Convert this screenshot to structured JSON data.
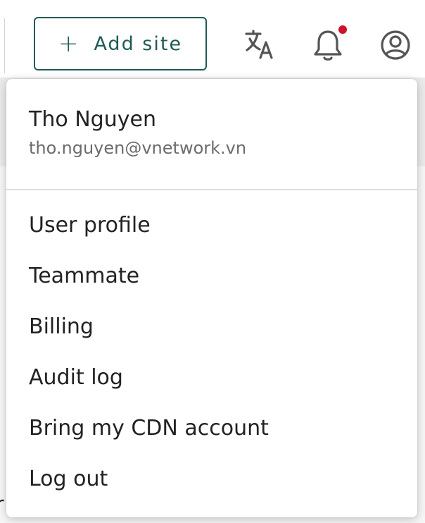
{
  "header": {
    "add_site_label": "Add site",
    "add_site_icon": "plus-icon",
    "icons": [
      "translate-icon",
      "bell-icon",
      "account-circle-icon"
    ],
    "notification_dot_color": "#d0112b",
    "accent_color": "#1f5a55"
  },
  "account_menu": {
    "name": "Tho Nguyen",
    "email": "tho.nguyen@vnetwork.vn",
    "items": [
      "User profile",
      "Teammate",
      "Billing",
      "Audit log",
      "Bring my CDN account",
      "Log out"
    ]
  },
  "background": {
    "edge_fragment": "r"
  }
}
